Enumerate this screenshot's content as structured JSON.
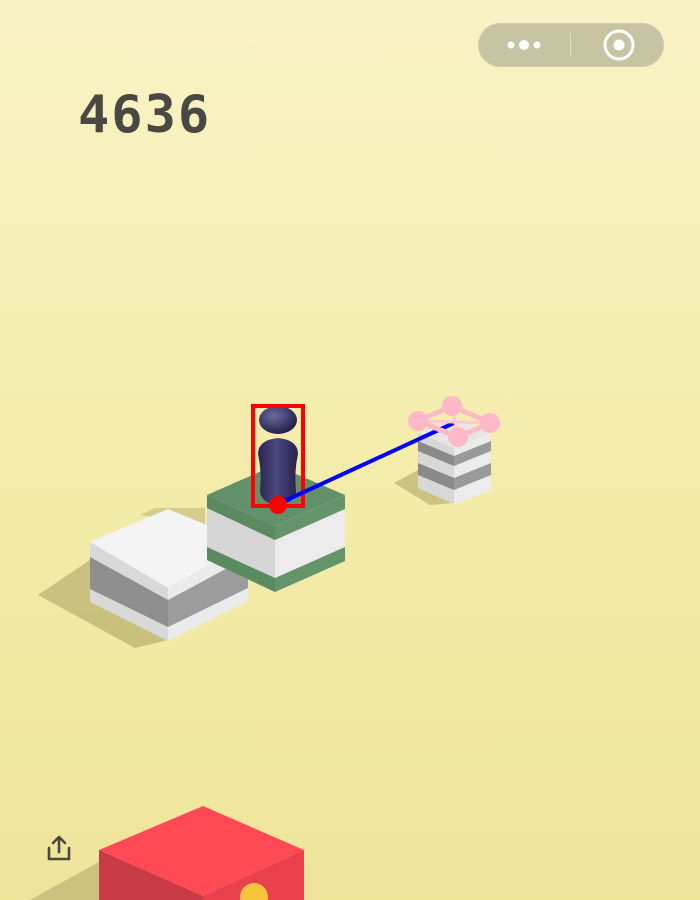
{
  "app": {
    "score": "4636"
  },
  "capsule": {
    "more_icon": "more-dots-icon",
    "close_icon": "target-circle-icon"
  },
  "share": {
    "icon": "share-upload-icon"
  },
  "colors": {
    "background": "#f3eca9",
    "score_text": "#4a4843",
    "capsule": "#c7c4a4",
    "player_body": "#2e2b55",
    "bbox_overlay": "#ff0000",
    "aim_line": "#0000ff",
    "target_marker": "#ffb8c8",
    "green_block_top": "#5e8f62",
    "red_block_top": "#ff4d56"
  },
  "scene": {
    "player": "chess-piece-player",
    "blocks": [
      "white-striped-block",
      "green-white-block",
      "small-striped-target-block",
      "red-block"
    ],
    "overlays": [
      "player-bounding-box",
      "player-base-point",
      "aim-line",
      "target-landing-marker"
    ]
  }
}
